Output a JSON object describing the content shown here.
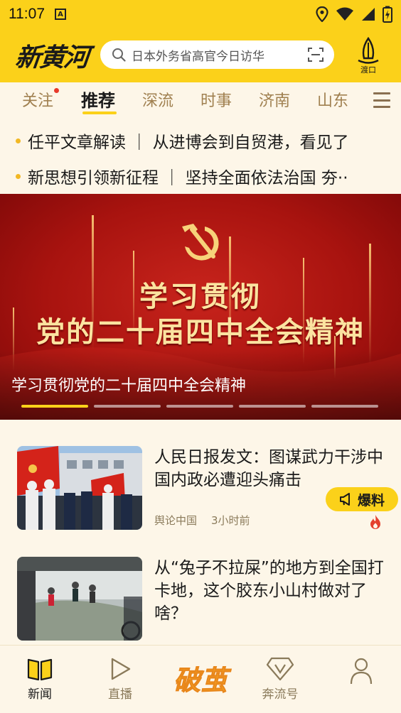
{
  "status_bar": {
    "time": "11:07",
    "notification_badge": "A"
  },
  "header": {
    "logo_text": "新黄河",
    "search_placeholder": "日本外务省高官今日访华",
    "ferry_label": "渡口"
  },
  "tabs": [
    {
      "label": "关注",
      "has_dot": true
    },
    {
      "label": "推荐",
      "active": true
    },
    {
      "label": "深流"
    },
    {
      "label": "时事"
    },
    {
      "label": "济南"
    },
    {
      "label": "山东"
    }
  ],
  "headlines": [
    {
      "text": "任平文章解读 ｜ 从进博会到自贸港，看见了"
    },
    {
      "text": "新思想引领新征程 ｜ 坚持全面依法治国 夯··"
    }
  ],
  "banner": {
    "line1": "学习贯彻",
    "line2": "党的二十届四中全会精神",
    "caption": "学习贯彻党的二十届四中全会精神",
    "slide_count": 5,
    "active_slide": 1
  },
  "news": [
    {
      "title": "人民日报发文：图谋武力干涉中国内政必遭迎头痛击",
      "source": "舆论中国",
      "time": "3小时前"
    },
    {
      "title": "从“兔子不拉屎”的地方到全国打卡地，这个胶东小山村做对了啥？",
      "source": "",
      "time": ""
    }
  ],
  "baoliao_label": "爆料",
  "bottom_nav": [
    {
      "label": "新闻",
      "active": true
    },
    {
      "label": "直播"
    },
    {
      "label": "破茧"
    },
    {
      "label": "奔流号"
    },
    {
      "label": ""
    }
  ],
  "colors": {
    "brand_yellow": "#fbd11a",
    "party_red": "#c8241c",
    "tab_inactive": "#a08050"
  }
}
